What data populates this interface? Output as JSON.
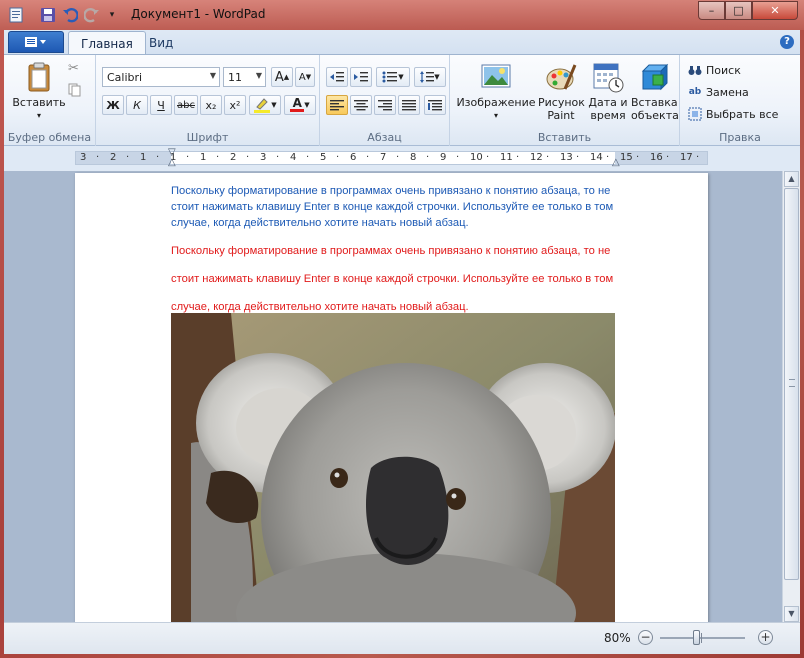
{
  "window": {
    "title": "Документ1 - WordPad",
    "controls": {
      "minimize": "–",
      "maximize": "□",
      "close": "✕"
    }
  },
  "tabs": [
    {
      "label": "Главная",
      "active": true
    },
    {
      "label": "Вид",
      "active": false
    }
  ],
  "ribbon": {
    "clipboard": {
      "label": "Буфер обмена",
      "paste": "Вставить"
    },
    "font": {
      "label": "Шрифт",
      "family": "Calibri",
      "size": "11",
      "bold": "Ж",
      "italic": "К",
      "underline": "Ч",
      "strike": "abc",
      "subscript": "x₂",
      "superscript": "x²",
      "grow": "A",
      "shrink": "A"
    },
    "paragraph": {
      "label": "Абзац"
    },
    "insert": {
      "label": "Вставить",
      "picture": "Изображение",
      "paint": "Рисунок Paint",
      "datetime": "Дата и время",
      "object": "Вставка объекта"
    },
    "editing": {
      "label": "Правка",
      "find": "Поиск",
      "replace": "Замена",
      "select_all": "Выбрать все"
    }
  },
  "ruler": {
    "labels": [
      "3",
      "2",
      "1",
      "1",
      "1",
      "2",
      "3",
      "4",
      "5",
      "6",
      "7",
      "8",
      "9",
      "10",
      "11",
      "12",
      "13",
      "14",
      "15",
      "16",
      "17"
    ]
  },
  "document": {
    "blue_paragraph": [
      "Поскольку форматирование в программах очень привязано к понятию абзаца, то не",
      "стоит нажимать клавишу Enter в конце каждой строчки. Используйте ее только в том",
      "случае, когда действительно хотите начать новый абзац."
    ],
    "red_paragraph": [
      "Поскольку форматирование в программах очень привязано к понятию абзаца, то не",
      " стоит нажимать клавишу Enter в конце каждой строчки. Используйте ее только в том",
      " случае, когда действительно хотите начать новый абзац."
    ]
  },
  "statusbar": {
    "zoom": "80%",
    "zoom_fraction": 0.42
  },
  "colors": {
    "blue_text": "#1d5ab5",
    "red_text": "#e11b1b",
    "ribbon_accent": "#2d6cc0"
  }
}
